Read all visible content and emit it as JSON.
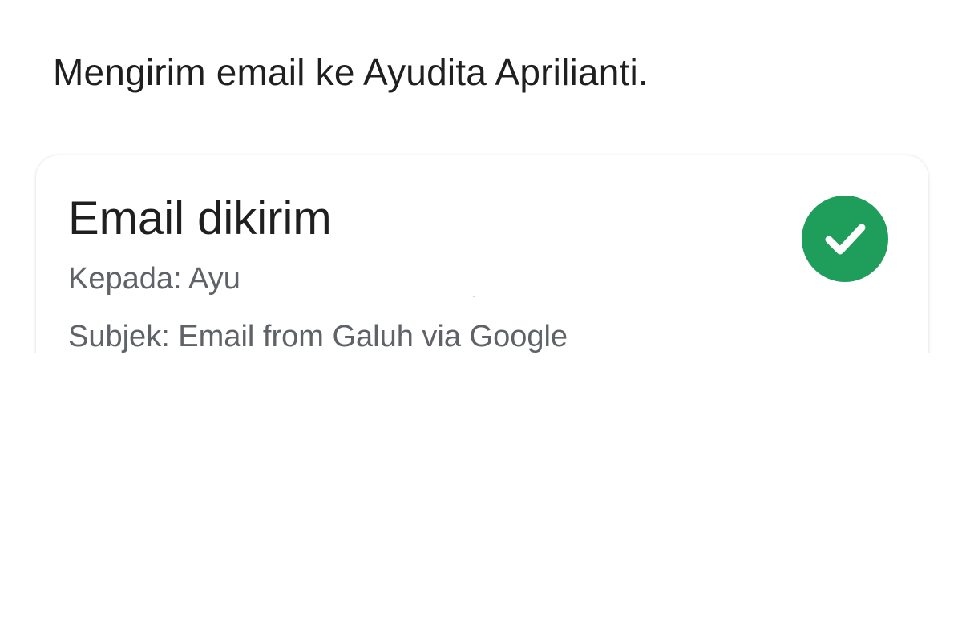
{
  "message": "Mengirim email ke Ayudita Aprilianti.",
  "card": {
    "title": "Email dikirim",
    "to_line": "Kepada: Ayu",
    "subject_line": "Subjek: Email from Galuh via Google",
    "status_icon": "check-circle-icon"
  },
  "colors": {
    "accent": "#1e9e5a",
    "text_primary": "#1f1f1f",
    "text_secondary": "#5f6368"
  }
}
